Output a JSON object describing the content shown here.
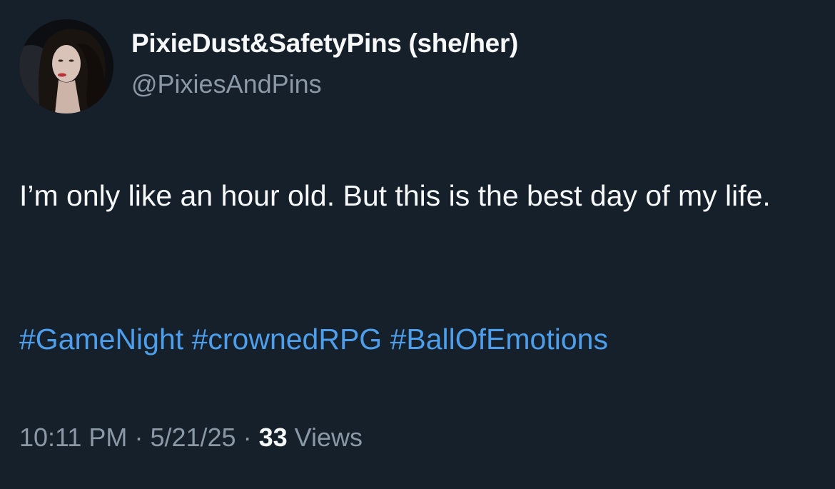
{
  "tweet": {
    "author": {
      "display_name": "PixieDust&SafetyPins (she/her)",
      "handle": "@PixiesAndPins"
    },
    "text": "I’m only like an hour old. But this is the best day of my life.",
    "hashtags": [
      "#GameNight",
      "#crownedRPG",
      "#BallOfEmotions"
    ],
    "meta": {
      "time": "10:11 PM",
      "separator": "·",
      "date": "5/21/25",
      "views_count": "33",
      "views_label": "Views"
    }
  },
  "colors": {
    "background": "#15202b",
    "primary_text": "#f7f9f9",
    "secondary_text": "#8b98a5",
    "link": "#4d9eeb"
  }
}
